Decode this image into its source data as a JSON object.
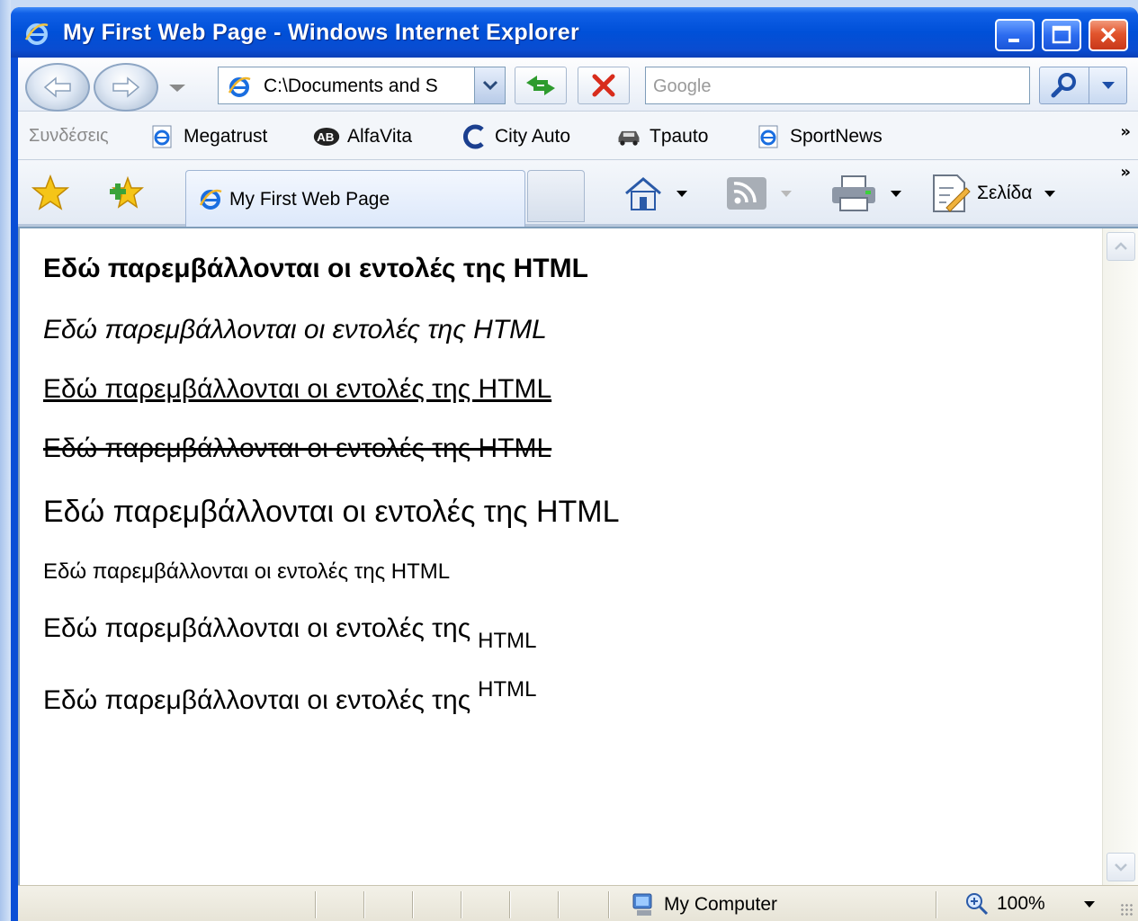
{
  "window": {
    "title": "My First Web Page - Windows Internet Explorer"
  },
  "toolbar": {
    "address_value": "C:\\Documents and S",
    "search_placeholder": "Google"
  },
  "links_bar": {
    "label": "Συνδέσεις",
    "items": [
      {
        "label": "Megatrust",
        "icon": "ie-page-icon"
      },
      {
        "label": "AlfaVita",
        "icon": "ab-icon"
      },
      {
        "label": "City Auto",
        "icon": "c-logo-icon"
      },
      {
        "label": "Τpauto",
        "icon": "car-icon"
      },
      {
        "label": "SportNews",
        "icon": "ie-page-icon"
      }
    ],
    "more": "»"
  },
  "tabs": {
    "active_label": "My First Web Page",
    "more": "»"
  },
  "commands": {
    "page_label": "Σελίδα"
  },
  "content": {
    "lines": [
      {
        "text": "Εδώ παρεμβάλλονται οι εντολές της HTML",
        "style": "bold"
      },
      {
        "text": "Εδώ παρεμβάλλονται οι εντολές της HTML",
        "style": "italic"
      },
      {
        "text": "Εδώ παρεμβάλλονται οι εντολές της HTML",
        "style": "underline"
      },
      {
        "text": "Εδώ παρεμβάλλονται οι εντολές της HTML",
        "style": "strike"
      },
      {
        "text": "Εδώ παρεμβάλλονται οι εντολές της HTML",
        "style": "big"
      },
      {
        "text": "Εδώ παρεμβάλλονται οι εντολές της HTML",
        "style": "small"
      }
    ],
    "sub_line": {
      "text": "Εδώ παρεμβάλλονται οι εντολές της",
      "sub": "HTML"
    },
    "sup_line": {
      "text": "Εδώ παρεμβάλλονται οι εντολές της",
      "sup": "HTML"
    }
  },
  "status": {
    "zone": "My Computer",
    "zoom": "100%"
  },
  "colors": {
    "titlebar": "#0050d8",
    "close_button": "#e2552d",
    "page_background": "#ffffff"
  }
}
